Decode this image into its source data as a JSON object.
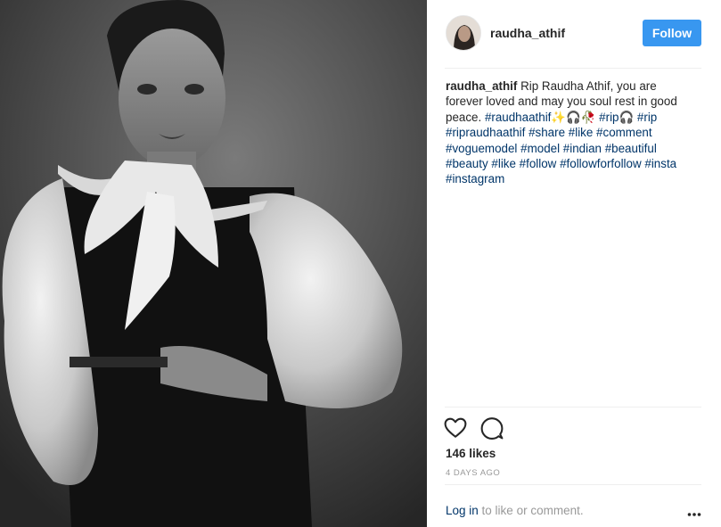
{
  "post": {
    "username": "raudha_athif",
    "follow_label": "Follow",
    "caption": {
      "username": "raudha_athif",
      "text_before": " Rip Raudha Athif, you are forever loved and may you soul rest in good peace. ",
      "tags": [
        "#raudhaathif✨🎧🥀",
        "#rip🎧",
        "#rip",
        "#ripraudhaathif",
        "#share",
        "#like",
        "#comment",
        "#voguemodel",
        "#model",
        "#indian",
        "#beautiful",
        "#beauty",
        "#like",
        "#follow",
        "#followforfollow",
        "#insta",
        "#instagram"
      ]
    },
    "likes": "146 likes",
    "time_ago": "4 DAYS AGO",
    "footer": {
      "login_link": "Log in",
      "login_suffix": " to like or comment."
    }
  },
  "icons": {
    "like": "heart-icon",
    "comment": "comment-icon",
    "more": "more-options-icon"
  },
  "colors": {
    "follow_button": "#3897f0",
    "hashtag": "#003569",
    "muted": "#999999",
    "text": "#262626"
  }
}
